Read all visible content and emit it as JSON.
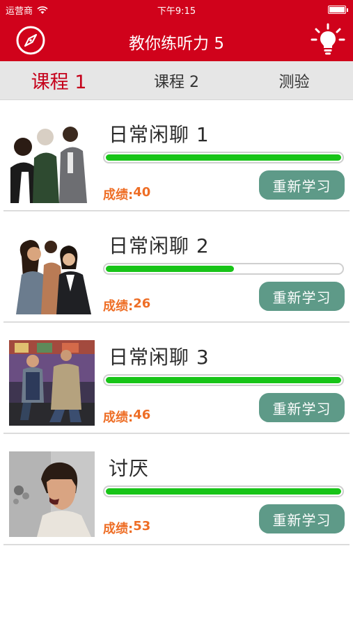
{
  "status_bar": {
    "carrier": "运营商",
    "time": "下午9:15",
    "wifi_icon": "wifi-icon",
    "battery_icon": "battery-icon"
  },
  "nav": {
    "title": "教你练听力 5",
    "left_icon": "compass-icon",
    "right_icon": "lightbulb-icon"
  },
  "tabs": [
    {
      "label": "课程 1",
      "active": true
    },
    {
      "label": "课程 2",
      "active": false
    },
    {
      "label": "测验",
      "active": false
    }
  ],
  "lessons": [
    {
      "title": "日常闲聊 1",
      "progress": 1.0,
      "score_label": "成绩:",
      "score": "40",
      "button": "重新学习"
    },
    {
      "title": "日常闲聊 2",
      "progress": 0.55,
      "score_label": "成绩:",
      "score": "26",
      "button": "重新学习"
    },
    {
      "title": "日常闲聊 3",
      "progress": 1.0,
      "score_label": "成绩:",
      "score": "46",
      "button": "重新学习"
    },
    {
      "title": "讨厌",
      "progress": 1.0,
      "score_label": "成绩:",
      "score": "53",
      "button": "重新学习"
    }
  ],
  "colors": {
    "brand_red": "#d0021b",
    "progress_green": "#18c418",
    "button_teal": "#5e9a88",
    "score_orange": "#ee6e26"
  }
}
